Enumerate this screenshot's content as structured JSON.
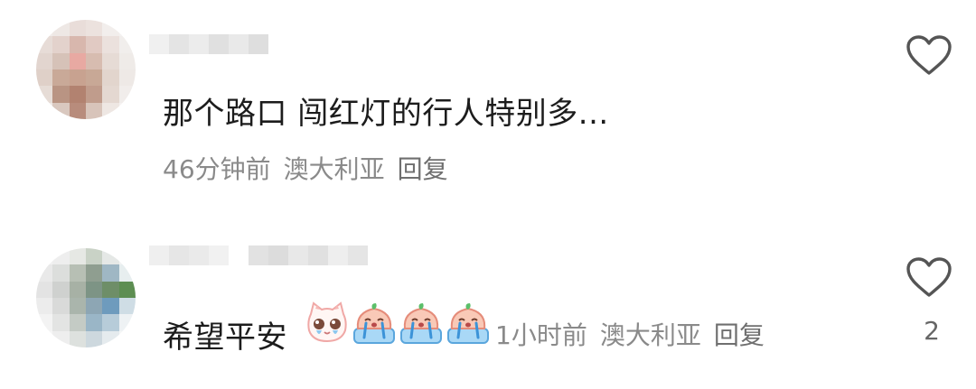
{
  "comments": [
    {
      "text": "那个路口 闯红灯的行人特别多...",
      "time": "46分钟前",
      "location": "澳大利亚",
      "reply_label": "回复",
      "like_count": ""
    },
    {
      "text": "希望平安",
      "emojis": [
        "cat-crying-emoji",
        "peach-crying-emoji",
        "peach-crying-emoji",
        "peach-crying-emoji"
      ],
      "time": "1小时前",
      "location": "澳大利亚",
      "reply_label": "回复",
      "like_count": "2"
    }
  ],
  "colors": {
    "text": "#1c1c1c",
    "meta": "#8a8a8a",
    "icon": "#555555"
  }
}
